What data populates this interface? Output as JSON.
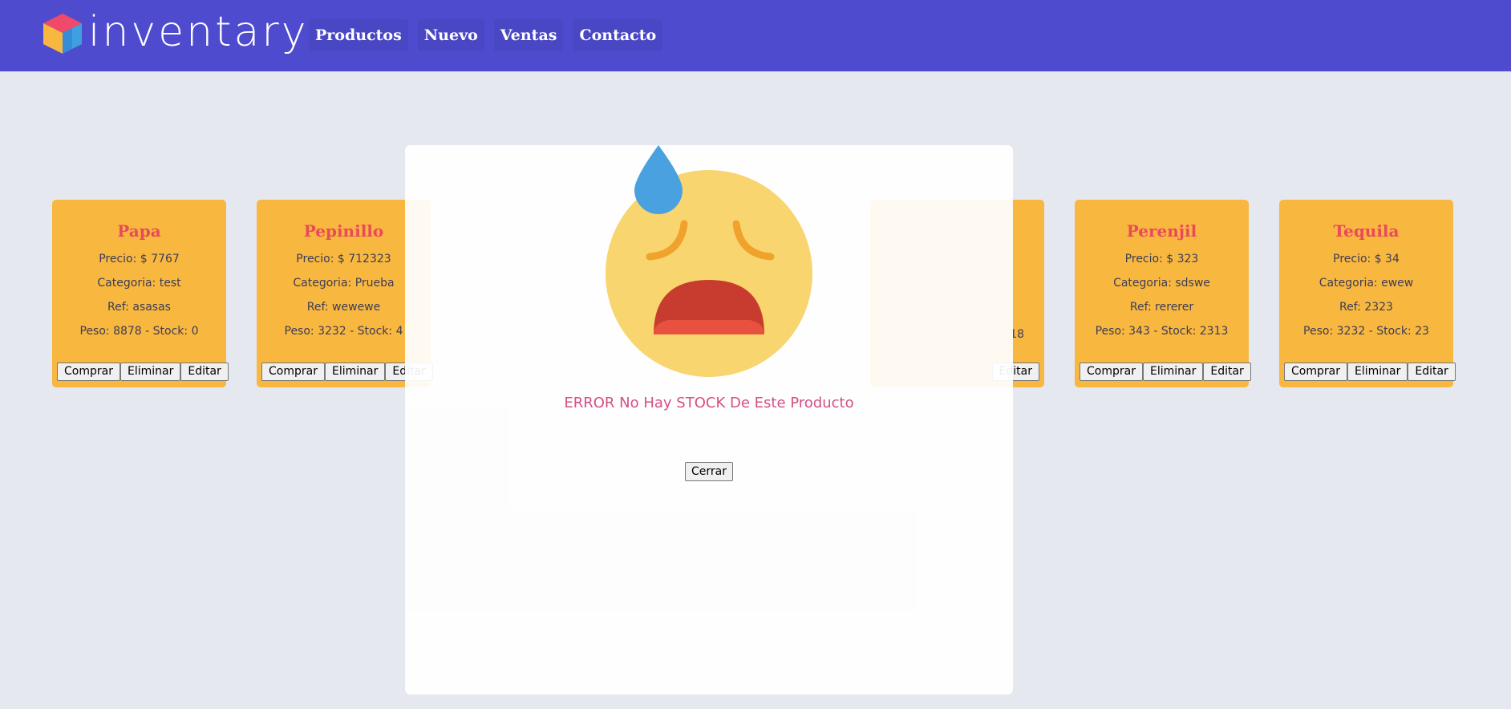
{
  "nav": {
    "brand": "inventary",
    "links": [
      "Productos",
      "Nuevo",
      "Ventas",
      "Contacto"
    ]
  },
  "buttons": {
    "buy": "Comprar",
    "delete": "Eliminar",
    "edit": "Editar"
  },
  "products": [
    {
      "name": "Papa",
      "precio": "Precio: $ 7767",
      "categoria": "Categoria: test",
      "ref": "Ref: asasas",
      "peso_stock": "Peso: 8878 - Stock: 0"
    },
    {
      "name": "Pepinillo",
      "precio": "Precio: $ 712323",
      "categoria": "Categoria: Prueba",
      "ref": "Ref: wewewe",
      "peso_stock": "Peso: 3232 - Stock: 4"
    },
    {
      "name": "Perenjil",
      "precio": "Precio: $ 323",
      "categoria": "Categoria: sdswe",
      "ref": "Ref: rererer",
      "peso_stock": "Peso: 343 - Stock: 2313"
    },
    {
      "name": "Tequila",
      "precio": "Precio: $ 34",
      "categoria": "Categoria: ewew",
      "ref": "Ref: 2323",
      "peso_stock": "Peso: 3232 - Stock: 23"
    }
  ],
  "partial_card": {
    "stock_fragment": "18"
  },
  "modal": {
    "message": "ERROR No Hay STOCK De Este Producto",
    "close_label": "Cerrar"
  },
  "colors": {
    "navbar": "#4f4bcf",
    "card": "#f8b73f",
    "product_name": "#e94a5a",
    "error_text": "#d64e83",
    "background": "#e6e8f0"
  }
}
